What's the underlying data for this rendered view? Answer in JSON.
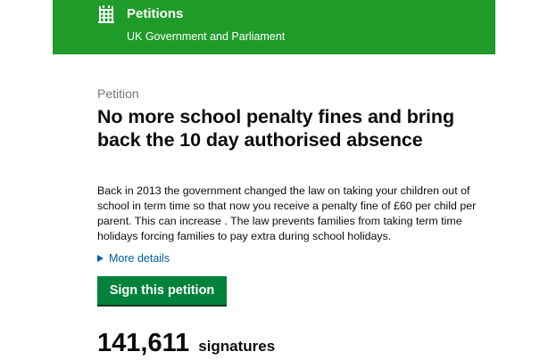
{
  "header": {
    "site_name": "Petitions",
    "subtitle": "UK Government and Parliament",
    "background_color": "#1f9b2a",
    "crest_icon": "portcullis-icon"
  },
  "petition": {
    "eyebrow": "Petition",
    "title": "No more school penalty fines and bring back the 10 day authorised absence",
    "body": "Back in 2013 the government changed the law on taking your children out of school in term time so that now you receive a penalty fine of £60 per child per parent. This can increase . The law prevents families from taking term time holidays forcing families to pay extra during school holidays.",
    "more_details_label": "More details",
    "sign_button_label": "Sign this petition",
    "signature_count": "141,611",
    "signature_label": "signatures"
  },
  "colors": {
    "button": "#00823b",
    "link": "#005ea5",
    "secondary_text": "#6f777b"
  }
}
